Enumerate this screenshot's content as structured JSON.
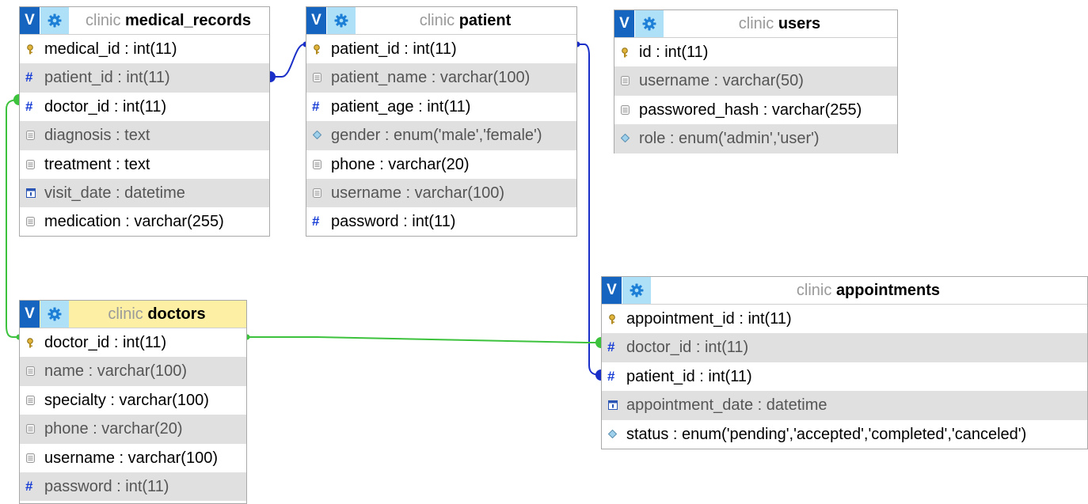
{
  "colors": {
    "blue_link": "#1a2fc8",
    "green_link": "#3cc23c",
    "header_highlight": "#fdf0a4",
    "v_button": "#1565c0",
    "gear_bg": "#aee0f7"
  },
  "tables": {
    "medical_records": {
      "db": "clinic",
      "name": "medical_records",
      "columns": [
        {
          "icon": "key",
          "text": "medical_id : int(11)"
        },
        {
          "icon": "hash",
          "text": "patient_id : int(11)"
        },
        {
          "icon": "hash",
          "text": "doctor_id : int(11)"
        },
        {
          "icon": "text",
          "text": "diagnosis : text"
        },
        {
          "icon": "text",
          "text": "treatment : text"
        },
        {
          "icon": "date",
          "text": "visit_date : datetime"
        },
        {
          "icon": "text",
          "text": "medication : varchar(255)"
        }
      ]
    },
    "patient": {
      "db": "clinic",
      "name": "patient",
      "columns": [
        {
          "icon": "key",
          "text": "patient_id : int(11)"
        },
        {
          "icon": "text",
          "text": "patient_name : varchar(100)"
        },
        {
          "icon": "hash",
          "text": "patient_age : int(11)"
        },
        {
          "icon": "enum",
          "text": "gender : enum('male','female')"
        },
        {
          "icon": "text",
          "text": "phone : varchar(20)"
        },
        {
          "icon": "text",
          "text": "username : varchar(100)"
        },
        {
          "icon": "hash",
          "text": "password : int(11)"
        }
      ]
    },
    "users": {
      "db": "clinic",
      "name": "users",
      "columns": [
        {
          "icon": "key",
          "text": "id : int(11)"
        },
        {
          "icon": "text",
          "text": "username : varchar(50)"
        },
        {
          "icon": "text",
          "text": "passwored_hash : varchar(255)"
        },
        {
          "icon": "enum",
          "text": "role : enum('admin','user')"
        }
      ]
    },
    "doctors": {
      "db": "clinic",
      "name": "doctors",
      "columns": [
        {
          "icon": "key",
          "text": "doctor_id : int(11)"
        },
        {
          "icon": "text",
          "text": "name : varchar(100)"
        },
        {
          "icon": "text",
          "text": "specialty : varchar(100)"
        },
        {
          "icon": "text",
          "text": "phone : varchar(20)"
        },
        {
          "icon": "text",
          "text": "username : varchar(100)"
        },
        {
          "icon": "hash",
          "text": "password : int(11)"
        }
      ]
    },
    "appointments": {
      "db": "clinic",
      "name": "appointments",
      "columns": [
        {
          "icon": "key",
          "text": "appointment_id : int(11)"
        },
        {
          "icon": "hash",
          "text": "doctor_id : int(11)"
        },
        {
          "icon": "hash",
          "text": "patient_id : int(11)"
        },
        {
          "icon": "date",
          "text": "appointment_date : datetime"
        },
        {
          "icon": "enum",
          "text": "status : enum('pending','accepted','completed','canceled')"
        }
      ]
    }
  },
  "toggle_label": "V"
}
